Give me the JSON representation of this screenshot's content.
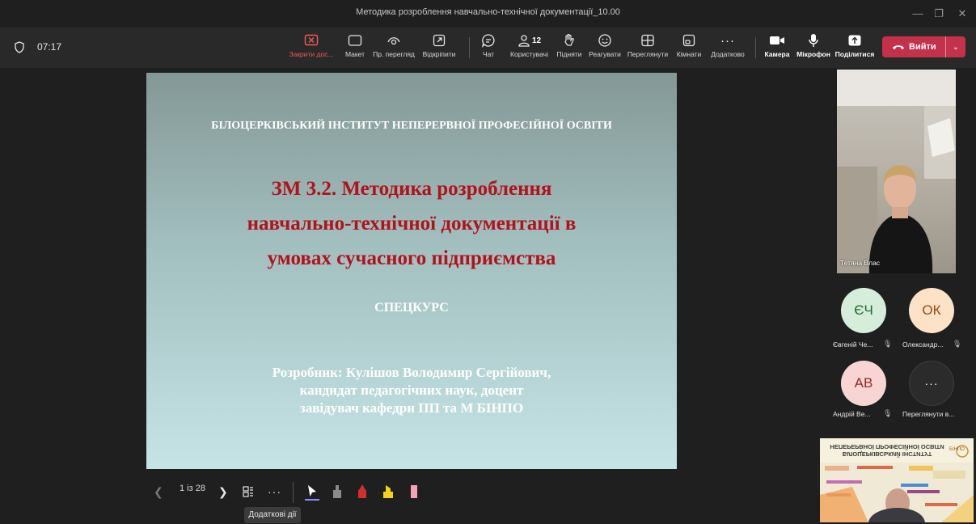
{
  "window": {
    "title": "Методика розроблення навчально-технічної документації_10.00"
  },
  "toolbar": {
    "timer": "07:17",
    "buttons": [
      {
        "label": "Закрити дос...",
        "icon": "close-sharing-icon"
      },
      {
        "label": "Макет",
        "icon": "layout-icon"
      },
      {
        "label": "Пр. перегляд",
        "icon": "eye-icon"
      },
      {
        "label": "Відкріпити",
        "icon": "popout-icon"
      },
      {
        "label": "Чат",
        "icon": "chat-icon"
      },
      {
        "label": "Користувачі",
        "icon": "people-icon",
        "badge": "12"
      },
      {
        "label": "Підняти",
        "icon": "raise-hand-icon"
      },
      {
        "label": "Реагувати",
        "icon": "smiley-icon"
      },
      {
        "label": "Переглянути",
        "icon": "view-icon"
      },
      {
        "label": "Кімнати",
        "icon": "rooms-icon"
      },
      {
        "label": "Додатково",
        "icon": "more-icon"
      },
      {
        "label": "Камера",
        "icon": "camera-icon"
      },
      {
        "label": "Мікрофон",
        "icon": "microphone-icon"
      },
      {
        "label": "Поділитися",
        "icon": "share-icon"
      }
    ],
    "leave_label": "Вийти"
  },
  "slide": {
    "institute": "БІЛОЦЕРКІВСЬКИЙ ІНСТИТУТ НЕПЕРЕРВНОЇ ПРОФЕСІЙНОЇ ОСВІТИ",
    "title_line1": "ЗМ 3.2. Методика розроблення",
    "title_line2": "навчально-технічної документації в",
    "title_line3": "умовах сучасного підприємства",
    "course": "СПЕЦКУРС",
    "author_line1": "Розробник: Кулішов Володимир Сергійович,",
    "author_line2": "кандидат педагогічних наук, доцент",
    "author_line3": "завідувач кафедри ПП та М БІНПО"
  },
  "slide_controls": {
    "page": "1 із 28",
    "tooltip": "Додаткові дії",
    "pen_colors": [
      "#8a8a8a",
      "#d32f2f",
      "#f2d21b",
      "#f4a3b4"
    ]
  },
  "participants": {
    "presenter_video_name": "Тетяна Влас",
    "list": [
      {
        "initials": "ЄЧ",
        "name": "Євгеній Че...",
        "bg": "#d7eddb",
        "fg": "#1e6b2d"
      },
      {
        "initials": "ОК",
        "name": "Олександр...",
        "bg": "#fde2c7",
        "fg": "#9a4a10"
      },
      {
        "initials": "АВ",
        "name": "Андрій Ве...",
        "bg": "#f8d4d4",
        "fg": "#8e2a2a"
      }
    ],
    "more_label": "Переглянути в..."
  },
  "thumbnail": {
    "banner_line1": "БІЛОЦЕРКІВСЬКИЙ ІНСТИТУТ",
    "banner_line2": "НЕПЕРЕРВНОЇ ПРОФЕСІЙНОЇ ОСВІТИ",
    "logo_text": "БІНПО"
  }
}
